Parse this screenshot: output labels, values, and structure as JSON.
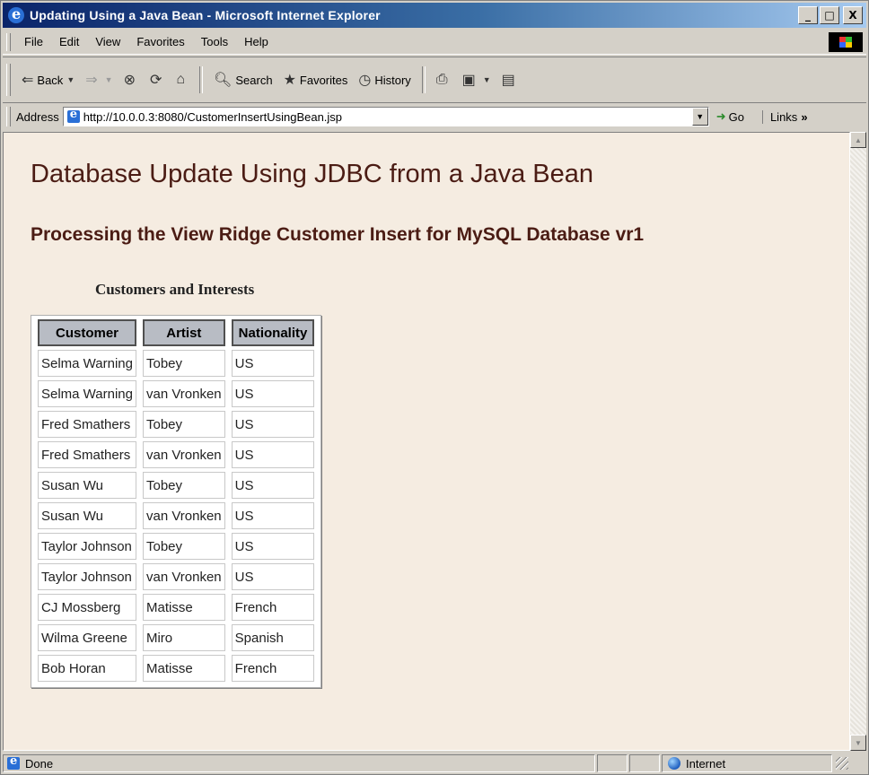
{
  "window": {
    "title": "Updating Using a Java Bean - Microsoft Internet Explorer",
    "controls": {
      "minimize": "_",
      "maximize": "□",
      "close": "X"
    }
  },
  "menu": [
    "File",
    "Edit",
    "View",
    "Favorites",
    "Tools",
    "Help"
  ],
  "toolbar": {
    "back_label": "Back",
    "search_label": "Search",
    "favorites_label": "Favorites",
    "history_label": "History"
  },
  "address": {
    "label": "Address",
    "url": "http://10.0.0.3:8080/CustomerInsertUsingBean.jsp",
    "go_label": "Go",
    "links_label": "Links"
  },
  "page": {
    "heading": "Database Update Using JDBC from a Java Bean",
    "subheading": "Processing the View Ridge Customer Insert for MySQL Database vr1",
    "table_caption": "Customers and Interests",
    "table": {
      "headers": [
        "Customer",
        "Artist",
        "Nationality"
      ],
      "rows": [
        [
          "Selma Warning",
          "Tobey",
          "US"
        ],
        [
          "Selma Warning",
          "van Vronken",
          "US"
        ],
        [
          "Fred Smathers",
          "Tobey",
          "US"
        ],
        [
          "Fred Smathers",
          "van Vronken",
          "US"
        ],
        [
          "Susan Wu",
          "Tobey",
          "US"
        ],
        [
          "Susan Wu",
          "van Vronken",
          "US"
        ],
        [
          "Taylor Johnson",
          "Tobey",
          "US"
        ],
        [
          "Taylor Johnson",
          "van Vronken",
          "US"
        ],
        [
          "CJ Mossberg",
          "Matisse",
          "French"
        ],
        [
          "Wilma Greene",
          "Miro",
          "Spanish"
        ],
        [
          "Bob Horan",
          "Matisse",
          "French"
        ]
      ]
    }
  },
  "status": {
    "text": "Done",
    "zone": "Internet"
  },
  "colors": {
    "page_background": "#f5ece1",
    "heading": "#4b1c14",
    "table_header_bg": "#b8bcc4"
  }
}
